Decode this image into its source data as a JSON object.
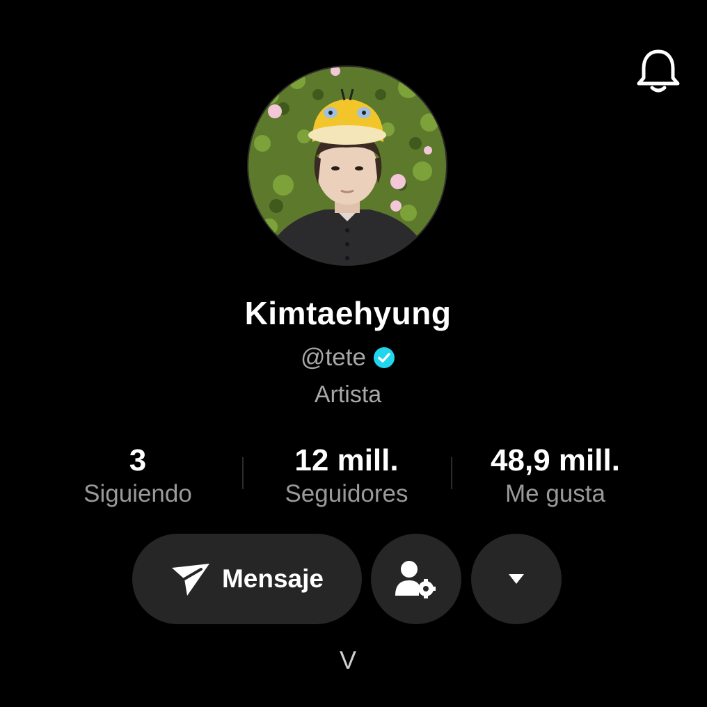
{
  "header": {
    "bell_icon": "bell-icon"
  },
  "profile": {
    "display_name": "Kimtaehyung",
    "handle": "@tete",
    "verified_icon": "verified-check-icon",
    "verified_color": "#20d5ec",
    "bio": "Artista"
  },
  "stats": [
    {
      "value": "3",
      "label": "Siguiendo"
    },
    {
      "value": "12 mill.",
      "label": "Seguidores"
    },
    {
      "value": "48,9 mill.",
      "label": "Me gusta"
    }
  ],
  "actions": {
    "message_label": "Mensaje",
    "message_icon": "send-icon",
    "user_settings_icon": "user-gear-icon",
    "more_icon": "caret-down-icon"
  },
  "footer": {
    "text": "V"
  },
  "colors": {
    "background": "#000000",
    "button_bg": "#262626",
    "secondary_text": "#a8a8a8"
  }
}
